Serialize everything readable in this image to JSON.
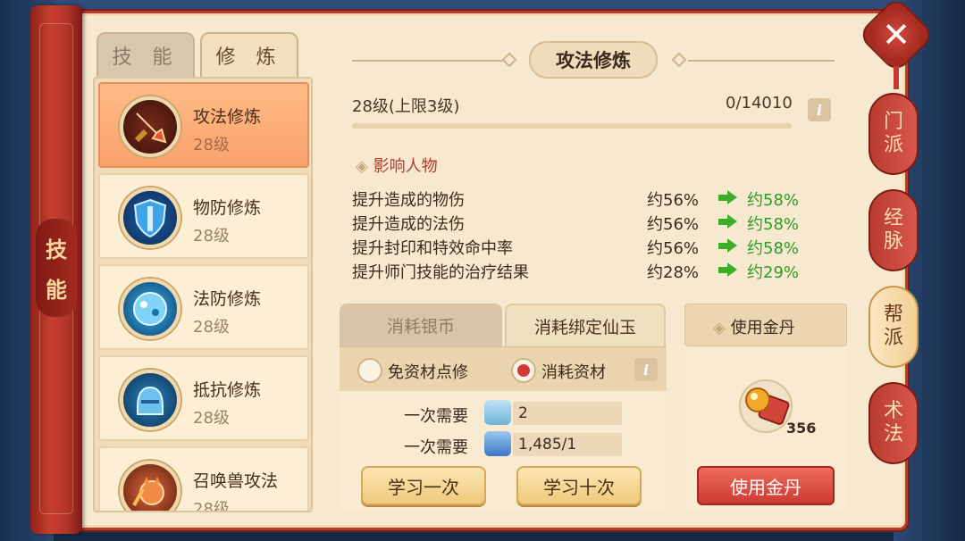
{
  "spine": {
    "title_1": "技",
    "title_2": "能"
  },
  "top_tabs": [
    {
      "label": "技 能",
      "active": false
    },
    {
      "label": "修 炼",
      "active": true
    }
  ],
  "skills": [
    {
      "name": "攻法修炼",
      "level": "28级",
      "icon": "sword-icon",
      "color": "#b3331f",
      "active": true
    },
    {
      "name": "物防修炼",
      "level": "28级",
      "icon": "shield-icon",
      "color": "#1c6cc1",
      "active": false
    },
    {
      "name": "法防修炼",
      "level": "28级",
      "icon": "orb-icon",
      "color": "#1f84c8",
      "active": false
    },
    {
      "name": "抵抗修炼",
      "level": "28级",
      "icon": "helmet-icon",
      "color": "#2a8cc0",
      "active": false
    },
    {
      "name": "召唤兽攻法",
      "level": "28级",
      "icon": "pet-icon",
      "color": "#d2522b",
      "active": false
    }
  ],
  "header": {
    "title": "攻法修炼"
  },
  "progress": {
    "level_text": "28级(上限3级)",
    "exp_text": "0/14010",
    "fraction": 0
  },
  "influence": {
    "title": "影响人物",
    "rows": [
      {
        "label": "提升造成的物伤",
        "current": "约56%",
        "next": "约58%"
      },
      {
        "label": "提升造成的法伤",
        "current": "约56%",
        "next": "约58%"
      },
      {
        "label": "提升封印和特效命中率",
        "current": "约56%",
        "next": "约58%"
      },
      {
        "label": "提升师门技能的治疗结果",
        "current": "约28%",
        "next": "约29%"
      }
    ]
  },
  "cost_tabs": {
    "silver": "消耗银币",
    "jade": "消耗绑定仙玉"
  },
  "radios": {
    "free": "免资材点修",
    "consume": "消耗资材",
    "selected": "consume"
  },
  "requirements": [
    {
      "label": "一次需要",
      "icon": "silver-icon",
      "value": "2"
    },
    {
      "label": "一次需要",
      "icon": "jade-icon",
      "value": "1,485/1"
    }
  ],
  "buttons": {
    "learn_once": "学习一次",
    "learn_ten": "学习十次",
    "use_pill": "使用金丹"
  },
  "pill": {
    "header": "使用金丹",
    "count": "356"
  },
  "side_tabs": [
    {
      "label_1": "门",
      "label_2": "派",
      "active": false
    },
    {
      "label_1": "经",
      "label_2": "脉",
      "active": false
    },
    {
      "label_1": "帮",
      "label_2": "派",
      "active": true
    },
    {
      "label_1": "术",
      "label_2": "法",
      "active": false
    }
  ],
  "close": "✕",
  "info_glyph": "i"
}
